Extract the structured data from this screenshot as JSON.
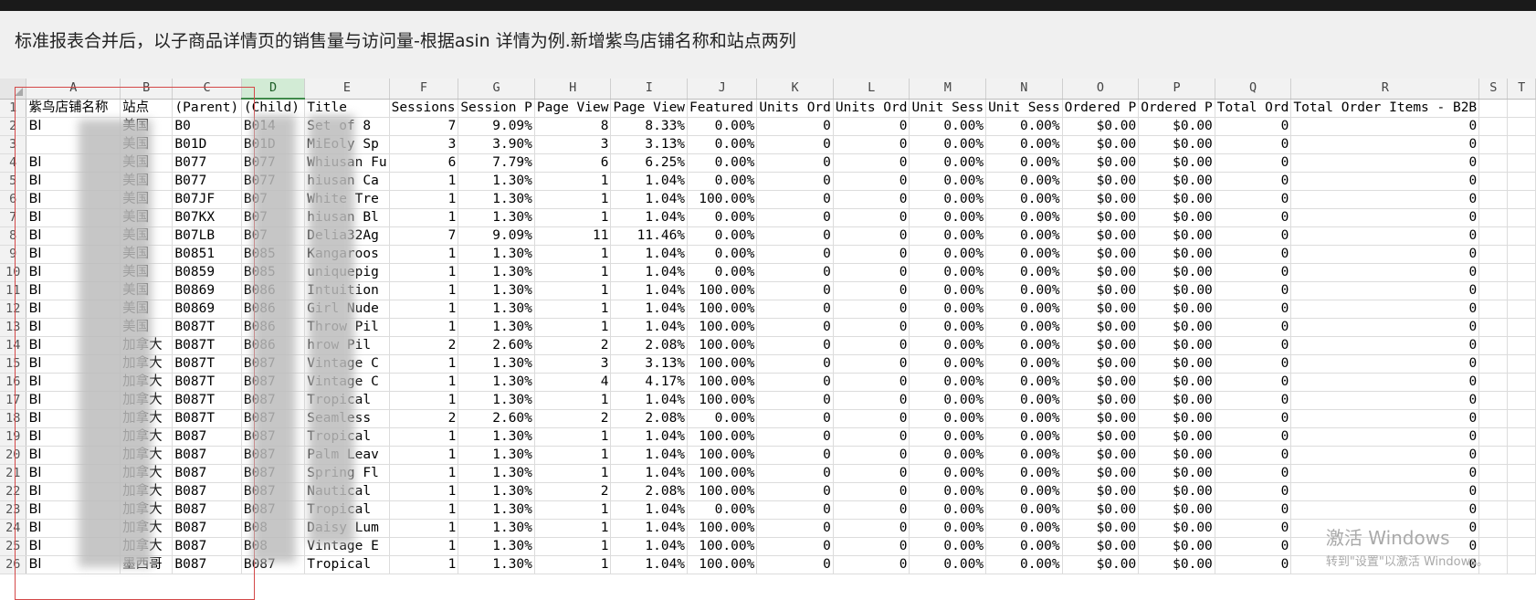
{
  "caption": "标准报表合并后，以子商品详情页的销售量与访问量-根据asin 详情为例.新增紫鸟店铺名称和站点两列",
  "column_letters": [
    "A",
    "B",
    "C",
    "D",
    "E",
    "F",
    "G",
    "H",
    "I",
    "J",
    "K",
    "L",
    "M",
    "N",
    "O",
    "P",
    "Q",
    "R",
    "S",
    "T"
  ],
  "selected_column": "D",
  "header_row": [
    "紫鸟店铺名称",
    "站点",
    "(Parent)",
    "(Child)",
    "Title",
    "Sessions",
    "Session P",
    "Page View",
    "Page View",
    "Featured",
    "Units Ord",
    "Units Ord",
    "Unit Sess",
    "Unit Sess",
    "Ordered P",
    "Ordered P",
    "Total Ord",
    "Total Order Items - B2B",
    "",
    ""
  ],
  "rows": [
    [
      "Bl",
      "美国",
      "B0",
      "B014",
      "Set of 8",
      "7",
      "9.09%",
      "8",
      "8.33%",
      "0.00%",
      "0",
      "0",
      "0.00%",
      "0.00%",
      "$0.00",
      "$0.00",
      "0",
      "0",
      "",
      ""
    ],
    [
      "",
      "美国",
      "B01D",
      "B01D",
      "MiEoly Sp",
      "3",
      "3.90%",
      "3",
      "3.13%",
      "0.00%",
      "0",
      "0",
      "0.00%",
      "0.00%",
      "$0.00",
      "$0.00",
      "0",
      "0",
      "",
      ""
    ],
    [
      "Bl",
      "美国",
      "B077",
      "B077",
      "Whiusan Fu",
      "6",
      "7.79%",
      "6",
      "6.25%",
      "0.00%",
      "0",
      "0",
      "0.00%",
      "0.00%",
      "$0.00",
      "$0.00",
      "0",
      "0",
      "",
      ""
    ],
    [
      "Bl",
      "美国",
      "B077",
      "B077",
      "hiusan Ca",
      "1",
      "1.30%",
      "1",
      "1.04%",
      "0.00%",
      "0",
      "0",
      "0.00%",
      "0.00%",
      "$0.00",
      "$0.00",
      "0",
      "0",
      "",
      ""
    ],
    [
      "Bl",
      "美国",
      "B07JF",
      "B07",
      "White Tre",
      "1",
      "1.30%",
      "1",
      "1.04%",
      "100.00%",
      "0",
      "0",
      "0.00%",
      "0.00%",
      "$0.00",
      "$0.00",
      "0",
      "0",
      "",
      ""
    ],
    [
      "Bl",
      "美国",
      "B07KX",
      "B07",
      "hiusan Bl",
      "1",
      "1.30%",
      "1",
      "1.04%",
      "0.00%",
      "0",
      "0",
      "0.00%",
      "0.00%",
      "$0.00",
      "$0.00",
      "0",
      "0",
      "",
      ""
    ],
    [
      "Bl",
      "美国",
      "B07LB",
      "B07",
      "Delia32Ag",
      "7",
      "9.09%",
      "11",
      "11.46%",
      "0.00%",
      "0",
      "0",
      "0.00%",
      "0.00%",
      "$0.00",
      "$0.00",
      "0",
      "0",
      "",
      ""
    ],
    [
      "Bl",
      "美国",
      "B0851",
      "B085",
      "Kangaroos",
      "1",
      "1.30%",
      "1",
      "1.04%",
      "0.00%",
      "0",
      "0",
      "0.00%",
      "0.00%",
      "$0.00",
      "$0.00",
      "0",
      "0",
      "",
      ""
    ],
    [
      "Bl",
      "美国",
      "B0859",
      "B085",
      "uniquepig",
      "1",
      "1.30%",
      "1",
      "1.04%",
      "0.00%",
      "0",
      "0",
      "0.00%",
      "0.00%",
      "$0.00",
      "$0.00",
      "0",
      "0",
      "",
      ""
    ],
    [
      "Bl",
      "美国",
      "B0869",
      "B086",
      "Intuition",
      "1",
      "1.30%",
      "1",
      "1.04%",
      "100.00%",
      "0",
      "0",
      "0.00%",
      "0.00%",
      "$0.00",
      "$0.00",
      "0",
      "0",
      "",
      ""
    ],
    [
      "Bl",
      "美国",
      "B0869",
      "B086",
      "Girl Nude",
      "1",
      "1.30%",
      "1",
      "1.04%",
      "100.00%",
      "0",
      "0",
      "0.00%",
      "0.00%",
      "$0.00",
      "$0.00",
      "0",
      "0",
      "",
      ""
    ],
    [
      "Bl",
      "美国",
      "B087T",
      "B086",
      "Throw Pil",
      "1",
      "1.30%",
      "1",
      "1.04%",
      "100.00%",
      "0",
      "0",
      "0.00%",
      "0.00%",
      "$0.00",
      "$0.00",
      "0",
      "0",
      "",
      ""
    ],
    [
      "Bl",
      "加拿大",
      "B087T",
      "B086",
      "hrow Pil",
      "2",
      "2.60%",
      "2",
      "2.08%",
      "100.00%",
      "0",
      "0",
      "0.00%",
      "0.00%",
      "$0.00",
      "$0.00",
      "0",
      "0",
      "",
      ""
    ],
    [
      "Bl",
      "加拿大",
      "B087T",
      "B087",
      "Vintage C",
      "1",
      "1.30%",
      "3",
      "3.13%",
      "100.00%",
      "0",
      "0",
      "0.00%",
      "0.00%",
      "$0.00",
      "$0.00",
      "0",
      "0",
      "",
      ""
    ],
    [
      "Bl",
      "加拿大",
      "B087T",
      "B087",
      "Vintage C",
      "1",
      "1.30%",
      "4",
      "4.17%",
      "100.00%",
      "0",
      "0",
      "0.00%",
      "0.00%",
      "$0.00",
      "$0.00",
      "0",
      "0",
      "",
      ""
    ],
    [
      "Bl",
      "加拿大",
      "B087T",
      "B087",
      "Tropical",
      "1",
      "1.30%",
      "1",
      "1.04%",
      "100.00%",
      "0",
      "0",
      "0.00%",
      "0.00%",
      "$0.00",
      "$0.00",
      "0",
      "0",
      "",
      ""
    ],
    [
      "Bl",
      "加拿大",
      "B087T",
      "B087",
      "Seamless",
      "2",
      "2.60%",
      "2",
      "2.08%",
      "0.00%",
      "0",
      "0",
      "0.00%",
      "0.00%",
      "$0.00",
      "$0.00",
      "0",
      "0",
      "",
      ""
    ],
    [
      "Bl",
      "加拿大",
      "B087",
      "B087",
      "Tropical",
      "1",
      "1.30%",
      "1",
      "1.04%",
      "100.00%",
      "0",
      "0",
      "0.00%",
      "0.00%",
      "$0.00",
      "$0.00",
      "0",
      "0",
      "",
      ""
    ],
    [
      "Bl",
      "加拿大",
      "B087",
      "B087",
      "Palm Leav",
      "1",
      "1.30%",
      "1",
      "1.04%",
      "100.00%",
      "0",
      "0",
      "0.00%",
      "0.00%",
      "$0.00",
      "$0.00",
      "0",
      "0",
      "",
      ""
    ],
    [
      "Bl",
      "加拿大",
      "B087",
      "B087",
      "Spring Fl",
      "1",
      "1.30%",
      "1",
      "1.04%",
      "100.00%",
      "0",
      "0",
      "0.00%",
      "0.00%",
      "$0.00",
      "$0.00",
      "0",
      "0",
      "",
      ""
    ],
    [
      "Bl",
      "加拿大",
      "B087",
      "B087",
      "Nautical",
      "1",
      "1.30%",
      "2",
      "2.08%",
      "100.00%",
      "0",
      "0",
      "0.00%",
      "0.00%",
      "$0.00",
      "$0.00",
      "0",
      "0",
      "",
      ""
    ],
    [
      "Bl",
      "加拿大",
      "B087",
      "B087",
      "Tropical",
      "1",
      "1.30%",
      "1",
      "1.04%",
      "0.00%",
      "0",
      "0",
      "0.00%",
      "0.00%",
      "$0.00",
      "$0.00",
      "0",
      "0",
      "",
      ""
    ],
    [
      "Bl",
      "加拿大",
      "B087",
      "B08",
      "Daisy Lum",
      "1",
      "1.30%",
      "1",
      "1.04%",
      "100.00%",
      "0",
      "0",
      "0.00%",
      "0.00%",
      "$0.00",
      "$0.00",
      "0",
      "0",
      "",
      ""
    ],
    [
      "Bl",
      "加拿大",
      "B087",
      "B08",
      "Vintage E",
      "1",
      "1.30%",
      "1",
      "1.04%",
      "100.00%",
      "0",
      "0",
      "0.00%",
      "0.00%",
      "$0.00",
      "$0.00",
      "0",
      "0",
      "",
      ""
    ],
    [
      "Bl",
      "墨西哥",
      "B087",
      "B087",
      "Tropical",
      "1",
      "1.30%",
      "1",
      "1.04%",
      "100.00%",
      "0",
      "0",
      "0.00%",
      "0.00%",
      "$0.00",
      "$0.00",
      "0",
      "0",
      "",
      ""
    ]
  ],
  "watermark": {
    "line1": "激活 Windows",
    "line2": "转到\"设置\"以激活 Windows。"
  }
}
